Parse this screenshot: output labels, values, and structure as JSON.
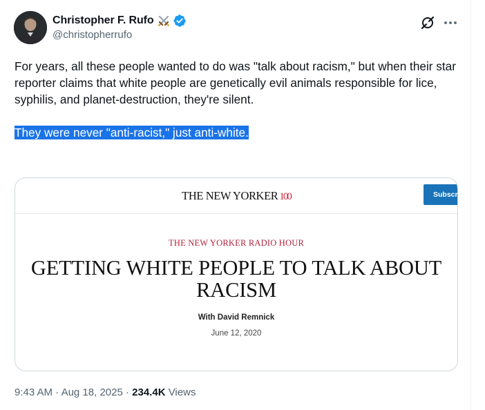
{
  "author": {
    "display_name": "Christopher F. Rufo",
    "handle": "@christopherrufo"
  },
  "tweet": {
    "text_1": "For years, all these people wanted to do was \"talk about racism,\" but when their star reporter claims that white people are genetically evil animals responsible for lice, syphilis, and planet-destruction, they're silent.",
    "text_2": "They were never \"anti-racist,\" just anti-white."
  },
  "card": {
    "site_logo": "THE NEW YORKER",
    "site_logo_suffix": "100",
    "subscribe_label": "Subscri",
    "kicker": "THE NEW YORKER RADIO HOUR",
    "headline": "GETTING WHITE PEOPLE TO TALK ABOUT RACISM",
    "byline": "With David Remnick",
    "date": "June 12, 2020"
  },
  "meta": {
    "time": "9:43 AM",
    "date": "Aug 18, 2025",
    "separator": "·",
    "views_count": "234.4K",
    "views_label": "Views"
  },
  "icons": {
    "grok": "grok-icon",
    "more": "more-icon",
    "verified": "verified-badge-icon",
    "emoji": "crossed-swords-icon",
    "verified_color": "#1d9bf0"
  }
}
